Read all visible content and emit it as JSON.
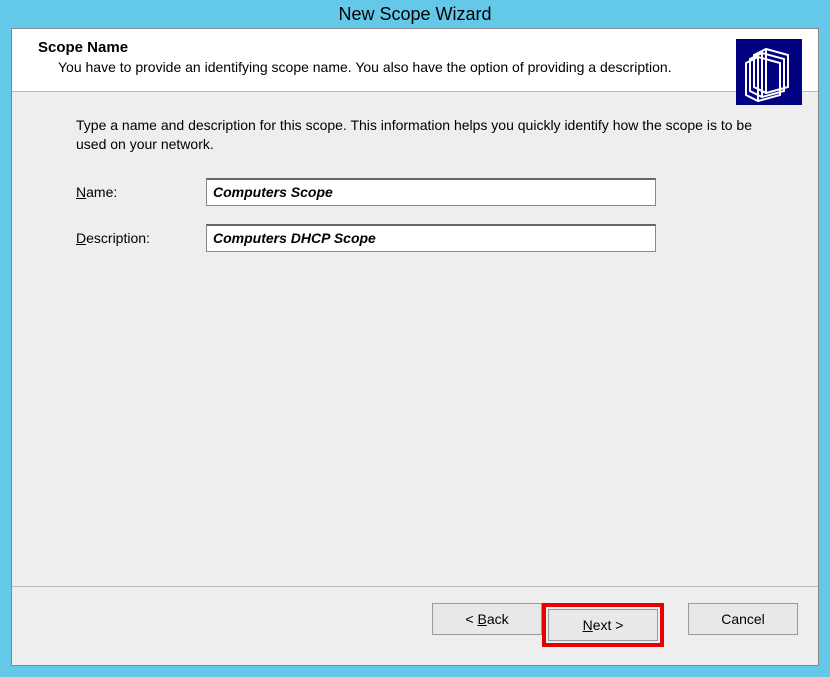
{
  "titlebar": {
    "title": "New Scope Wizard"
  },
  "header": {
    "title": "Scope Name",
    "subtitle": "You have to provide an identifying scope name. You also have the option of providing a description."
  },
  "content": {
    "intro": "Type a name and description for this scope. This information helps you quickly identify how the scope is to be used on your network.",
    "name_label_prefix": "N",
    "name_label_rest": "ame:",
    "name_value": "Computers Scope",
    "desc_label_prefix": "D",
    "desc_label_rest": "escription:",
    "desc_value": "Computers DHCP Scope"
  },
  "footer": {
    "back_prefix": "< ",
    "back_ul": "B",
    "back_rest": "ack",
    "next_ul": "N",
    "next_rest": "ext >",
    "cancel": "Cancel"
  }
}
